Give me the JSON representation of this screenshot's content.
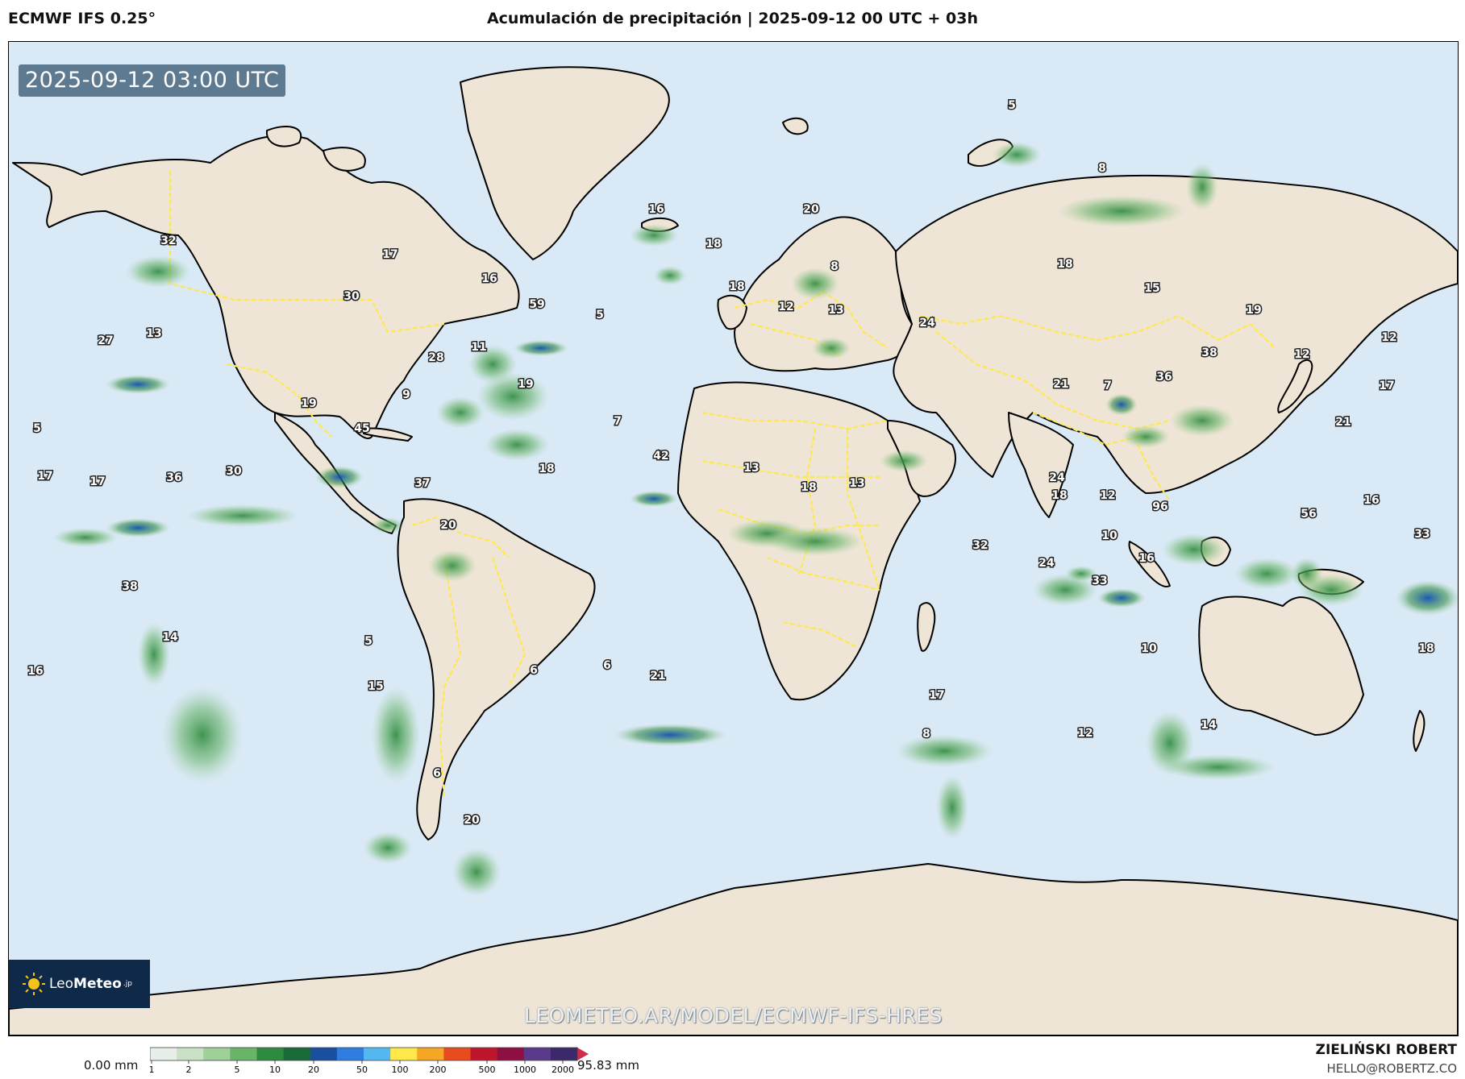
{
  "header": {
    "model": "ECMWF IFS 0.25°",
    "title": "Acumulación de precipitación | 2025-09-12 00 UTC + 03h"
  },
  "map": {
    "timestamp": "2025-09-12 03:00 UTC",
    "watermark": "LEOMETEO.AR/MODEL/ECMWF-IFS-HRES",
    "logo": {
      "name_light": "Leo",
      "name_bold": "Meteo",
      "suffix": ".jp"
    },
    "colors": {
      "ocean": "#d9e9f6",
      "land": "#efe5d6",
      "coast": "#000000",
      "borders": "#ffe94a",
      "precip_light": "#8fcf8d",
      "precip_mid": "#2e8a3e",
      "precip_heavy": "#1150b4"
    },
    "labels": [
      "5",
      "8",
      "20",
      "16",
      "18",
      "32",
      "17",
      "16",
      "30",
      "59",
      "5",
      "18",
      "12",
      "8",
      "13",
      "24",
      "18",
      "15",
      "19",
      "27",
      "13",
      "28",
      "11",
      "38",
      "12",
      "12",
      "17",
      "21",
      "7",
      "36",
      "19",
      "9",
      "5",
      "19",
      "45",
      "7",
      "42",
      "13",
      "18",
      "13",
      "18",
      "24",
      "21",
      "17",
      "17",
      "36",
      "30",
      "37",
      "18",
      "12",
      "96",
      "10",
      "20",
      "56",
      "32",
      "24",
      "16",
      "33",
      "33",
      "16",
      "38",
      "14",
      "6",
      "21",
      "6",
      "5",
      "15",
      "10",
      "17",
      "18",
      "12",
      "14",
      "8",
      "6",
      "20",
      "16"
    ]
  },
  "colorbar": {
    "min_label": "0.00 mm",
    "max_label": "95.83 mm",
    "ticks": [
      "1",
      "2",
      "5",
      "10",
      "20",
      "50",
      "100",
      "200",
      "500",
      "1000",
      "2000"
    ],
    "value": 95.83,
    "colors": [
      "#e8efe8",
      "#c9e2c6",
      "#9fd09a",
      "#6ab46a",
      "#2e8a3e",
      "#1b6b3a",
      "#1a4fa0",
      "#2e7de0",
      "#53b8f0",
      "#ffe84a",
      "#f5a623",
      "#e84c1e",
      "#c0162c",
      "#8e1042",
      "#5a3a8a",
      "#3b2a6b",
      "#d12b4a"
    ]
  },
  "credit": {
    "name": "ZIELIŃSKI ROBERT",
    "email": "HELLO@ROBERTZ.CO"
  }
}
